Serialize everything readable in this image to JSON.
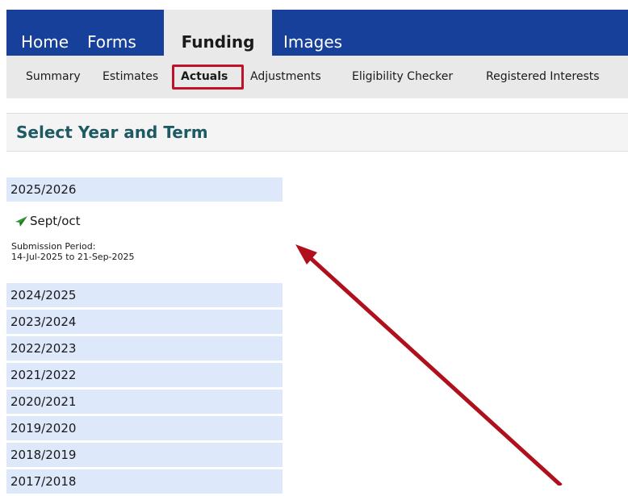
{
  "top_nav": {
    "items": [
      {
        "label": "Home"
      },
      {
        "label": "Forms"
      },
      {
        "label": "Funding",
        "active": true
      },
      {
        "label": "Images"
      }
    ],
    "bar_color": "#17409a",
    "active_color": "#e9e9e9"
  },
  "sub_nav": {
    "items": [
      {
        "label": "Summary"
      },
      {
        "label": "Estimates"
      },
      {
        "label": "Actuals",
        "active": true,
        "highlighted": true
      },
      {
        "label": "Adjustments"
      },
      {
        "label": "Eligibility Checker"
      },
      {
        "label": "Registered Interests"
      }
    ],
    "highlight_color": "#c0102a"
  },
  "page": {
    "title": "Select Year and Term",
    "title_color": "#1d5a63"
  },
  "years": [
    {
      "label": "2025/2026",
      "expanded": true
    },
    {
      "label": "2024/2025"
    },
    {
      "label": "2023/2024"
    },
    {
      "label": "2022/2023"
    },
    {
      "label": "2021/2022"
    },
    {
      "label": "2020/2021"
    },
    {
      "label": "2019/2020"
    },
    {
      "label": "2018/2019"
    },
    {
      "label": "2017/2018"
    }
  ],
  "term": {
    "icon": "send-arrow-icon",
    "label": "Sept/oct",
    "submission_label": "Submission Period:",
    "submission_range": "14-Jul-2025 to 21-Sep-2025",
    "icon_color": "#2e9b2e"
  },
  "annotation": {
    "icon": "pointer-arrow",
    "color": "#b0101c"
  },
  "colors": {
    "year_row_bg": "#dde8fa",
    "heading_bg": "#f4f4f4"
  }
}
